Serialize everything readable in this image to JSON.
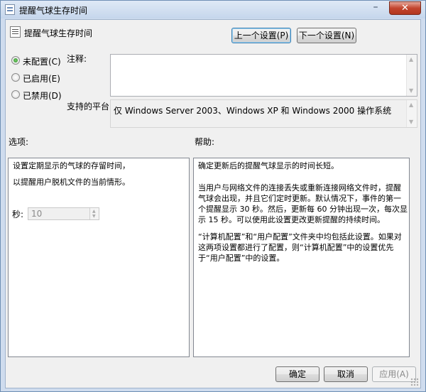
{
  "window": {
    "title": "提醒气球生存时间",
    "minimize_glyph": "–",
    "close_glyph": "✕"
  },
  "header": {
    "policy_title": "提醒气球生存时间",
    "prev_button": "上一个设置(P)",
    "next_button": "下一个设置(N)"
  },
  "state": {
    "options": [
      {
        "label": "未配置(C)",
        "checked": true
      },
      {
        "label": "已启用(E)",
        "checked": false
      },
      {
        "label": "已禁用(D)",
        "checked": false
      }
    ]
  },
  "comment": {
    "label": "注释:",
    "value": ""
  },
  "supported": {
    "label": "支持的平台:",
    "value": "仅 Windows Server 2003、Windows XP 和 Windows 2000 操作系统"
  },
  "options_panel": {
    "label": "选项:",
    "lines": [
      "设置定期显示的气球的存留时间，",
      "以提醒用户脱机文件的当前情形。"
    ],
    "seconds_label": "秒:",
    "seconds_value": "10"
  },
  "help_panel": {
    "label": "帮助:",
    "paragraphs": [
      "确定更新后的提醒气球显示的时间长短。",
      "当用户与网络文件的连接丢失或重新连接网络文件时，提醒气球会出现，并且它们定时更新。默认情况下，事件的第一个提醒显示 30 秒。然后，更新每 60 分钟出现一次，每次显示 15 秒。可以使用此设置更改更新提醒的持续时间。",
      "“计算机配置”和“用户配置”文件夹中均包括此设置。如果对这两项设置都进行了配置，则“计算机配置”中的设置优先于“用户配置”中的设置。"
    ]
  },
  "footer": {
    "ok": "确定",
    "cancel": "取消",
    "apply": "应用(A)"
  }
}
